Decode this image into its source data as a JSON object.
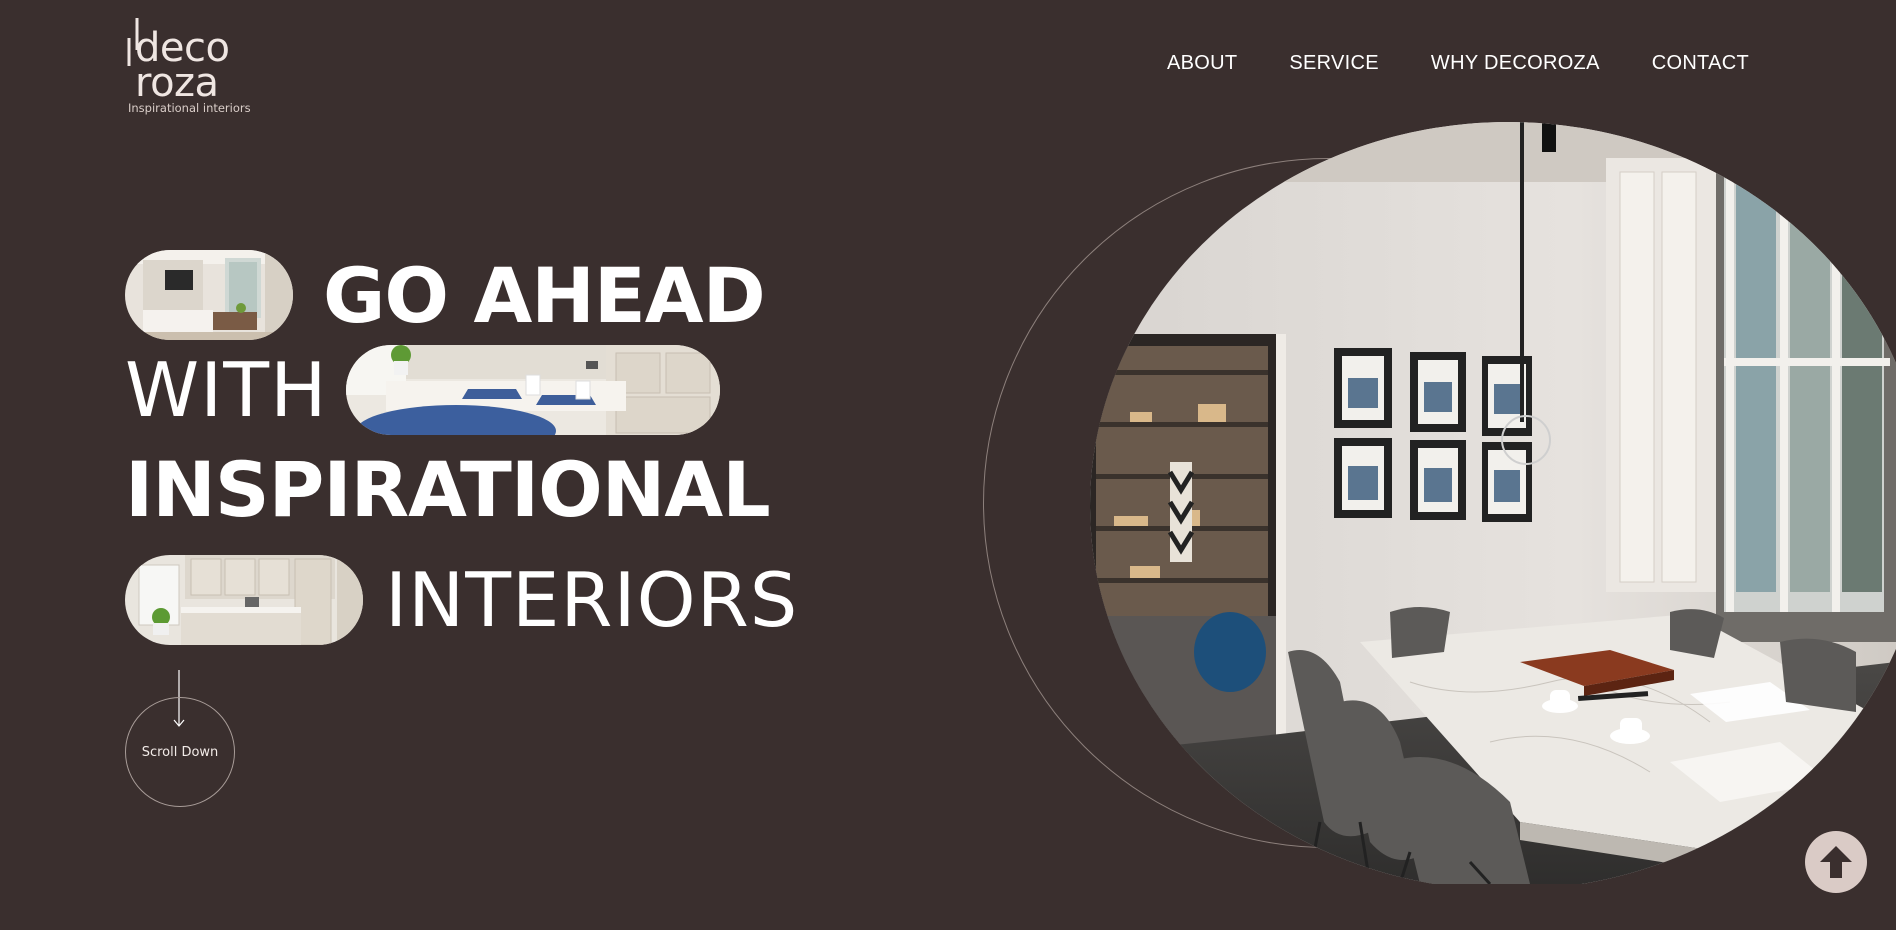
{
  "brand": {
    "logo_line1": "deco",
    "logo_line2": "roza",
    "tagline": "Inspirational interiors"
  },
  "nav": {
    "items": [
      {
        "label": "ABOUT"
      },
      {
        "label": "SERVICE"
      },
      {
        "label": "WHY DECOROZA"
      },
      {
        "label": "CONTACT"
      }
    ]
  },
  "hero": {
    "line1": "GO AHEAD",
    "line2": "WITH",
    "line3": "INSPIRATIONAL",
    "line4": "INTERIORS",
    "scroll_label": "Scroll Down",
    "images": [
      "living-room-thumbnail",
      "kitchen-dining-thumbnail",
      "white-kitchen-thumbnail",
      "meeting-room-photo"
    ]
  },
  "icons": {
    "scroll": "arrow-down-icon",
    "back_to_top": "arrow-up-icon"
  },
  "colors": {
    "background": "#3a2f2e",
    "text": "#ffffff",
    "back_to_top": "#dacbc6"
  }
}
